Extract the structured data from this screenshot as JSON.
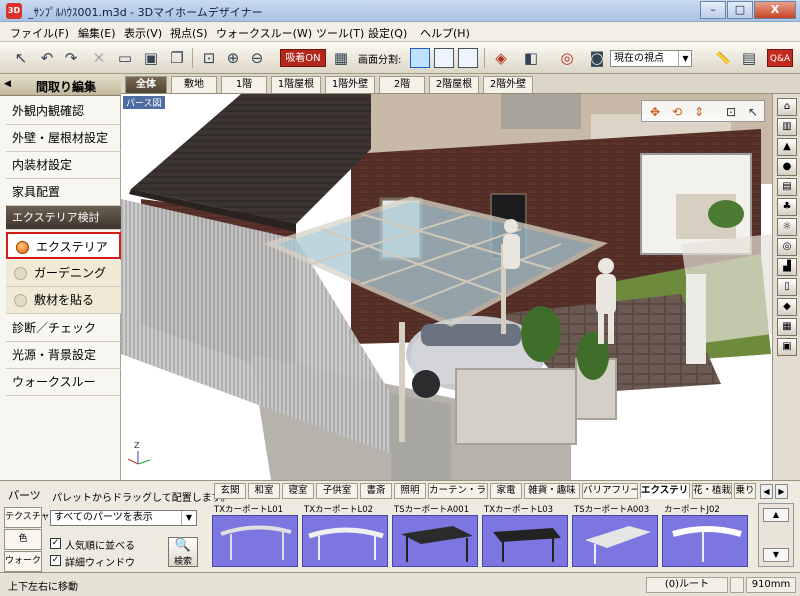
{
  "window": {
    "icon_text": "3D",
    "title": "_ｻﾝﾌﾟﾙﾊｳｽ001.m3d - 3Dマイホームデザイナー",
    "btn_minimize": "–",
    "btn_maximize": "□",
    "btn_close": "X"
  },
  "menu": [
    "ファイル(F)",
    "編集(E)",
    "表示(V)",
    "視点(S)",
    "ウォークスルー(W)",
    "ツール(T)",
    "設定(Q)",
    "ヘルプ(H)"
  ],
  "toolbar": {
    "kyuchaku": "吸着ON",
    "split_label": "画面分割:",
    "viewpoint": "現在の視点",
    "qa": "Q&A",
    "icons": {
      "select": "↖",
      "undo": "↶",
      "redo": "↷",
      "delete": "✕",
      "open": "▭",
      "save": "▣",
      "copy": "❐",
      "fit": "⊡",
      "zoom_in": "⊕",
      "zoom_out": "⊖",
      "grid": "▦",
      "render": "◈",
      "cube": "◧",
      "target": "◎",
      "camera": "◙",
      "ruler": "📏",
      "book": "▤"
    }
  },
  "left_panel": {
    "header": "間取り編集",
    "items": [
      "外観内観確認",
      "外壁・屋根材設定",
      "内装材設定",
      "家具配置"
    ],
    "section": "エクステリア検討",
    "sub_items": [
      "エクステリア",
      "ガーデニング",
      "敷材を貼る"
    ],
    "items2": [
      "診断／チェック",
      "光源・背景設定",
      "ウォークスルー"
    ]
  },
  "top_tabs": [
    "全体",
    "敷地",
    "1階",
    "1階屋根",
    "1階外壁",
    "2階",
    "2階屋根",
    "2階外壁"
  ],
  "viewport": {
    "label": "パース図",
    "axis": "Z  X  Y"
  },
  "bottom": {
    "parts_tab": "パーツ",
    "side_tabs": [
      "テクスチャ",
      "色",
      "ウォーク"
    ],
    "hint": "パレットからドラッグして配置します。",
    "filter": "すべてのパーツを表示",
    "check_popular": "人気順に並べる",
    "check_detail": "詳細ウィンドウ",
    "search": "検索",
    "categories": [
      "玄関",
      "和室",
      "寝室",
      "子供室",
      "書斎",
      "照明",
      "カーテン・ラグ",
      "家電",
      "雑貨・趣味",
      "バリアフリー",
      "エクステリア",
      "花・植栽",
      "乗り"
    ],
    "parts": [
      "TXカーポートL01",
      "TXカーポートL02",
      "TSカーポートA001",
      "TXカーポートL03",
      "TSカーポートA003",
      "カーポートJ02"
    ]
  },
  "status": {
    "text": "上下左右に移動",
    "route": "(0)ルート",
    "size": "910mm"
  }
}
